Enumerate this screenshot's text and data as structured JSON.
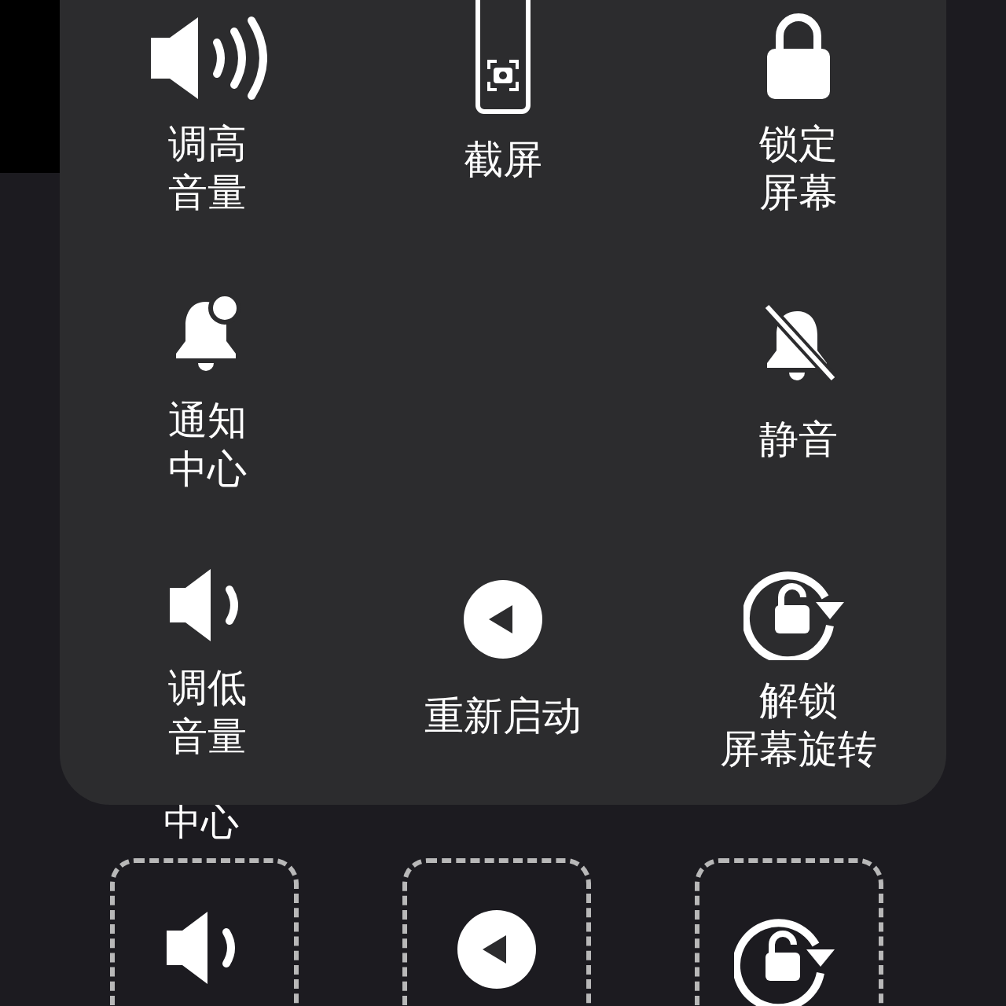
{
  "menu": {
    "items": [
      {
        "kind": "action",
        "lines": [
          "调高",
          "音量"
        ]
      },
      {
        "kind": "action",
        "lines": [
          "截屏"
        ]
      },
      {
        "kind": "action",
        "lines": [
          "锁定",
          "屏幕"
        ]
      },
      {
        "kind": "action",
        "lines": [
          "通知",
          "中心"
        ]
      },
      {
        "kind": "blank"
      },
      {
        "kind": "action",
        "lines": [
          "静音"
        ]
      },
      {
        "kind": "action",
        "lines": [
          "调低",
          "音量"
        ]
      },
      {
        "kind": "action",
        "lines": [
          "重新启动"
        ]
      },
      {
        "kind": "action",
        "lines": [
          "解锁",
          "屏幕旋转"
        ]
      }
    ]
  },
  "background": {
    "caption": "中心",
    "slots": [
      {
        "kind": "slot"
      },
      {
        "kind": "slot"
      },
      {
        "kind": "slot"
      }
    ]
  }
}
